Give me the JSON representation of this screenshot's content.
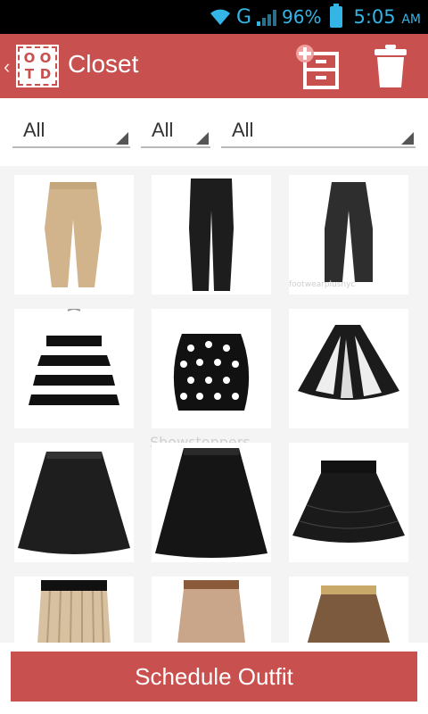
{
  "status_bar": {
    "network": "G",
    "battery_percent": "96%",
    "time": "5:05",
    "ampm": "AM",
    "color": "#33b5e5"
  },
  "action_bar": {
    "logo_letters": [
      "O",
      "O",
      "T",
      "D"
    ],
    "title": "Closet",
    "accent": "#c8504f"
  },
  "filters": [
    "All",
    "All",
    "All"
  ],
  "grid": {
    "items": [
      {
        "name": "beige-trousers"
      },
      {
        "name": "black-trousers"
      },
      {
        "name": "charcoal-trousers",
        "watermark": "footwearplusnyc"
      },
      {
        "name": "striped-skirt"
      },
      {
        "name": "polka-dot-skirt"
      },
      {
        "name": "lace-panel-skirt"
      },
      {
        "name": "leather-skater-skirt-1",
        "watermark": "Showstoppers"
      },
      {
        "name": "leather-skater-skirt-2"
      },
      {
        "name": "black-lace-skirt"
      },
      {
        "name": "pleated-beige-skirt"
      },
      {
        "name": "tan-belted-skirt"
      },
      {
        "name": "brown-flared-skirt"
      }
    ]
  },
  "schedule_button": "Schedule Outfit"
}
